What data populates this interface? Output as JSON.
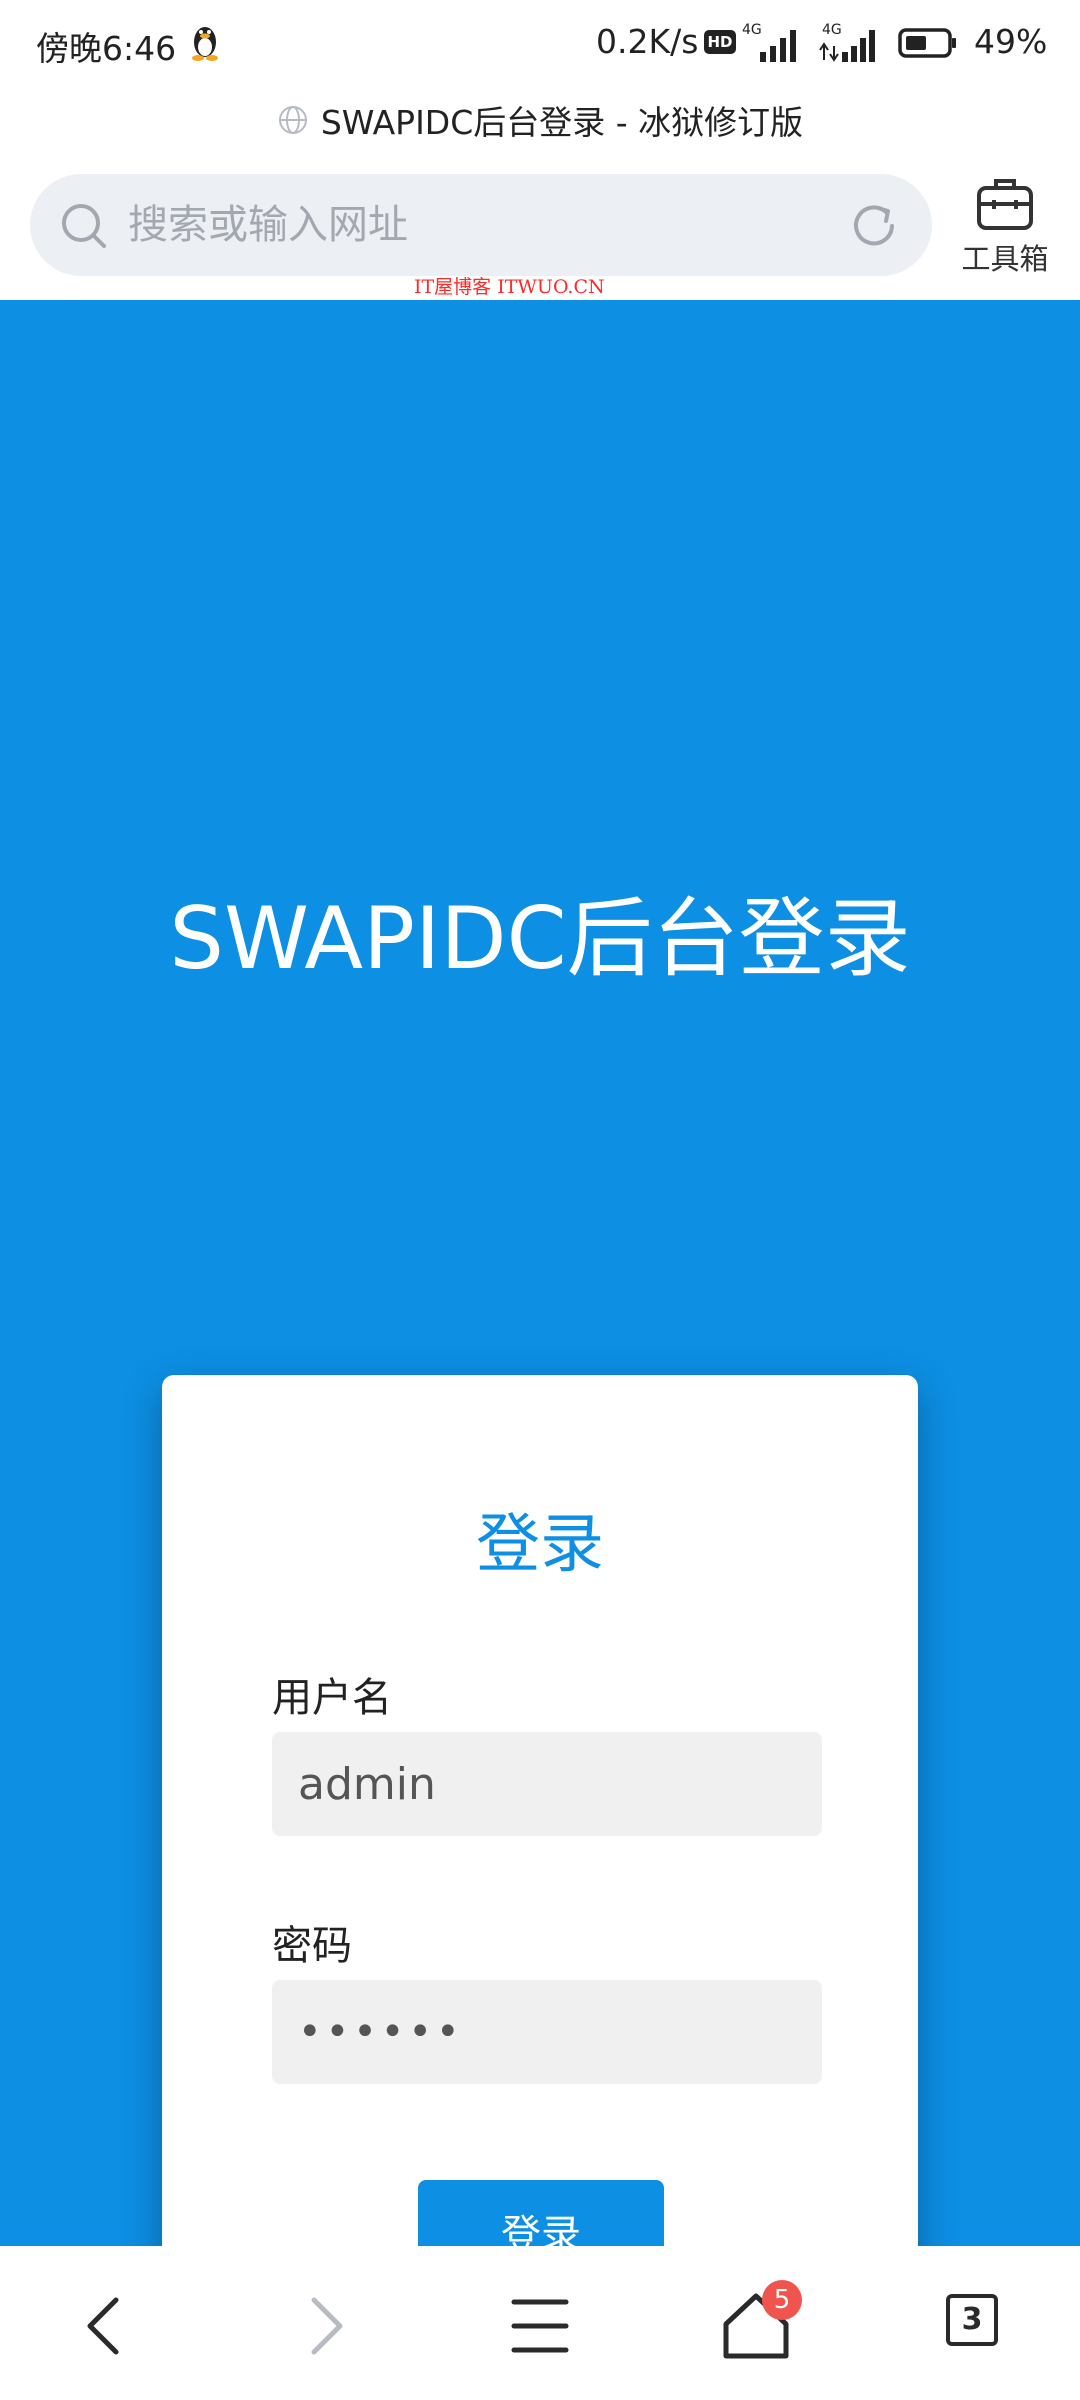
{
  "status_bar": {
    "time": "傍晚6:46",
    "net_speed": "0.2K/s",
    "hd_label": "HD",
    "signal_label": "4G",
    "battery": "49%"
  },
  "browser": {
    "page_title": "SWAPIDC后台登录 - 冰狱修订版",
    "address_placeholder": "搜索或输入网址",
    "toolbox_label": "工具箱",
    "watermark": "IT屋博客 ITWUO.CN"
  },
  "page": {
    "heading": "SWAPIDC后台登录",
    "card_title": "登录",
    "username_label": "用户名",
    "username_value": "admin",
    "password_label": "密码",
    "password_value": "••••••",
    "submit_label": "登录"
  },
  "bottom_nav": {
    "home_badge": "5",
    "tab_count": "3"
  },
  "colors": {
    "primary": "#0d8fe4",
    "input_bg": "#f0f0f0",
    "badge": "#f0544f"
  }
}
